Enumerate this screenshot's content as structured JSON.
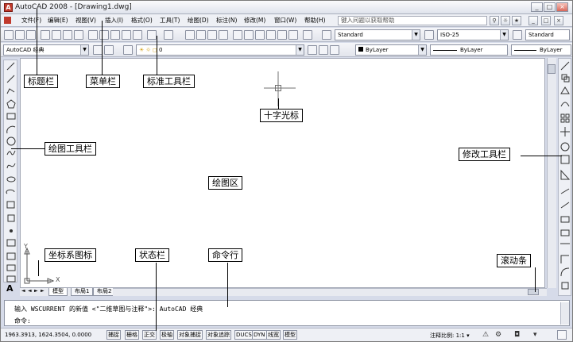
{
  "window": {
    "title": "AutoCAD 2008 - [Drawing1.dwg]",
    "app_icon_glyph": "A",
    "controls": [
      "_",
      "□",
      "×"
    ]
  },
  "menubar": {
    "items": [
      "文件(F)",
      "编辑(E)",
      "视图(V)",
      "插入(I)",
      "格式(O)",
      "工具(T)",
      "绘图(D)",
      "标注(N)",
      "修改(M)",
      "窗口(W)",
      "帮助(H)"
    ],
    "search_placeholder": "键入问题以获取帮助",
    "doc_controls": [
      "_",
      "□",
      "×"
    ]
  },
  "toolbar_styles": {
    "text_style": "Standard",
    "dim_style": "ISO-25",
    "table_style": "Standard"
  },
  "toolbar_props": {
    "workspace": "AutoCAD 经典",
    "layer": "0",
    "color": "ByLayer",
    "linetype": "ByLayer",
    "lineweight": "ByLayer"
  },
  "tabs": {
    "nav": [
      "◄",
      "◄",
      "►",
      "►"
    ],
    "items": [
      "模型",
      "布局1",
      "布局2"
    ]
  },
  "command": {
    "history": "输入 WSCURRENT 的新值 <\"二维草图与注释\">: AutoCAD 经典",
    "prompt": "命令:"
  },
  "status": {
    "coordinates": "1963.3913, 1624.3504, 0.0000",
    "toggles": [
      "捕捉",
      "栅格",
      "正交",
      "极轴",
      "对象捕捉",
      "对象追踪",
      "DUCS",
      "DYN",
      "线宽",
      "模型"
    ],
    "annotation_scale_label": "注释比例: 1:1 ▾"
  },
  "ucs": {
    "x_label": "X",
    "y_label": "Y"
  },
  "annotations": {
    "title_bar": "标题栏",
    "menu_bar": "菜单栏",
    "standard_toolbar": "标准工具栏",
    "crosshair": "十字光标",
    "draw_toolbar": "绘图工具栏",
    "modify_toolbar": "修改工具栏",
    "drawing_area": "绘图区",
    "ucs_icon": "坐标系图标",
    "status_bar": "状态栏",
    "command_line": "命令行",
    "scroll_bar": "滚动条"
  },
  "colors": {
    "frame": "#d6dbe9",
    "canvas": "#ffffff",
    "crosshair": "#707070"
  }
}
